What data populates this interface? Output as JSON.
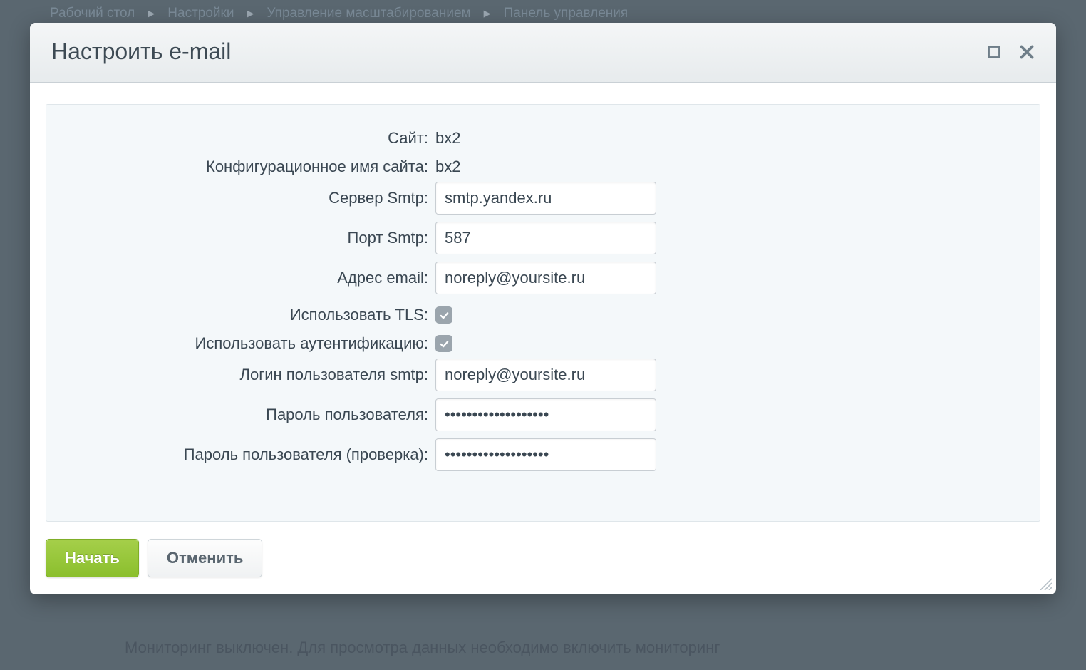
{
  "breadcrumb": {
    "items": [
      "Рабочий стол",
      "Настройки",
      "Управление масштабированием",
      "Панель управления"
    ]
  },
  "bg": {
    "monitoring_text": "Мониторинг выключен. Для просмотра данных необходимо включить мониторинг"
  },
  "modal": {
    "title": "Настроить e-mail",
    "form": {
      "site_label": "Сайт:",
      "site_value": "bx2",
      "conf_label": "Конфигурационное имя сайта:",
      "conf_value": "bx2",
      "smtp_server_label": "Сервер Smtp:",
      "smtp_server_value": "smtp.yandex.ru",
      "smtp_port_label": "Порт Smtp:",
      "smtp_port_value": "587",
      "email_label": "Адрес email:",
      "email_value": "noreply@yoursite.ru",
      "tls_label": "Использовать TLS:",
      "auth_label": "Использовать аутентификацию:",
      "login_label": "Логин пользователя smtp:",
      "login_value": "noreply@yoursite.ru",
      "pass_label": "Пароль пользователя:",
      "pass_value": "•••••••••••••••••••",
      "pass2_label": "Пароль пользователя (проверка):",
      "pass2_value": "•••••••••••••••••••"
    },
    "buttons": {
      "start": "Начать",
      "cancel": "Отменить"
    }
  }
}
